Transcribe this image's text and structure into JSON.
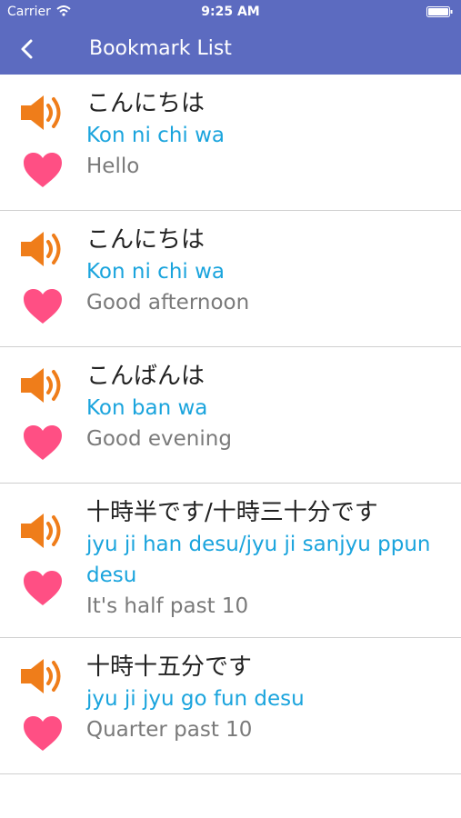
{
  "status_bar": {
    "carrier": "Carrier",
    "time": "9:25 AM"
  },
  "header": {
    "title": "Bookmark List"
  },
  "colors": {
    "header": "#5c6bc0",
    "romaji": "#1aa4dd",
    "speaker": "#ef7d1a",
    "heart": "#ff4f84"
  },
  "items": [
    {
      "japanese": "こんにちは",
      "romaji": "Kon ni chi wa",
      "english": "Hello"
    },
    {
      "japanese": "こんにちは",
      "romaji": "Kon ni chi wa",
      "english": "Good afternoon"
    },
    {
      "japanese": "こんばんは",
      "romaji": "Kon ban wa",
      "english": "Good evening"
    },
    {
      "japanese": "十時半です/十時三十分です",
      "romaji": "jyu ji han desu/jyu ji sanjyu ppun desu",
      "english": "It's half past 10"
    },
    {
      "japanese": "十時十五分です",
      "romaji": "jyu ji jyu go fun desu",
      "english": "Quarter past 10"
    }
  ]
}
